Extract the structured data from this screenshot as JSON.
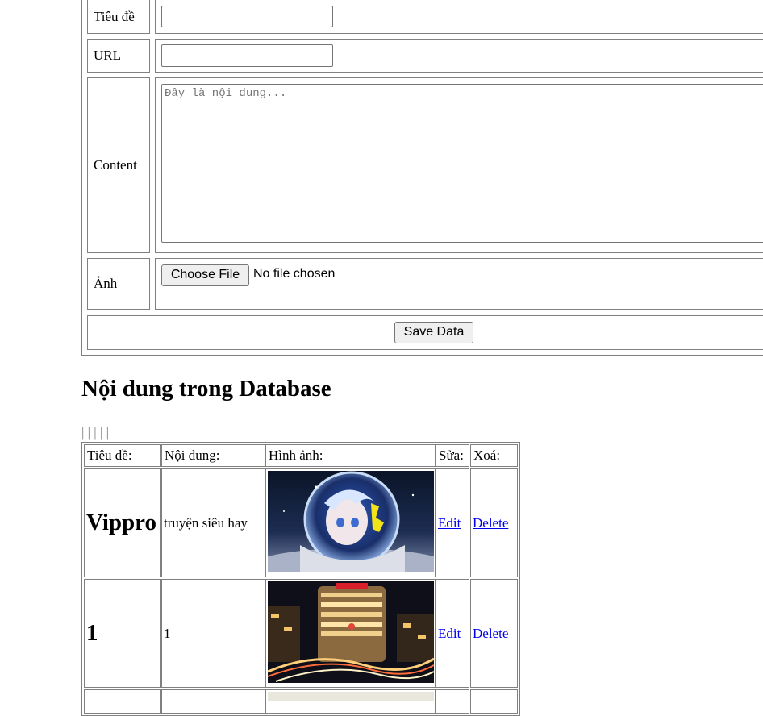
{
  "form": {
    "title_label": "Tiêu đề",
    "title_value": "",
    "url_label": "URL",
    "url_value": "",
    "content_label": "Content",
    "content_placeholder": "Đây là nội dung...",
    "image_label": "Ảnh",
    "choose_file_label": "Choose File",
    "no_file_text": "No file chosen",
    "save_label": "Save Data"
  },
  "section": {
    "heading": "Nội dung trong Database",
    "separators": "| | | | |"
  },
  "table": {
    "headers": [
      "Tiêu đề:",
      "Nội dung:",
      "Hình ảnh:",
      "Sửa:",
      "Xoá:"
    ],
    "rows": [
      {
        "title": "Vippro",
        "content": "truyện siêu hay",
        "image": "anime-astronaut-girl-image",
        "edit": "Edit",
        "delete": "Delete"
      },
      {
        "title": "1",
        "content": "1",
        "image": "night-city-building-image",
        "edit": "Edit",
        "delete": "Delete"
      }
    ]
  },
  "colors": {
    "link": "#0000ee",
    "border": "#808080",
    "button_bg": "#efefef"
  }
}
